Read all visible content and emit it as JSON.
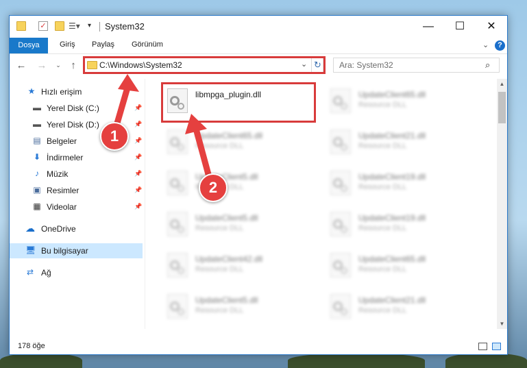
{
  "window": {
    "title": "System32",
    "controls": {
      "minimize": "—",
      "maximize": "☐",
      "close": "✕"
    },
    "help": "?"
  },
  "ribbon": {
    "tabs": [
      "Dosya",
      "Giriş",
      "Paylaş",
      "Görünüm"
    ]
  },
  "address_bar": {
    "path": "C:\\Windows\\System32",
    "search_placeholder": "Ara: System32"
  },
  "sidebar": {
    "items": [
      {
        "label": "Hızlı erişim",
        "icon": "star-icon"
      },
      {
        "label": "Yerel Disk (C:)",
        "icon": "drive-icon",
        "pinned": true
      },
      {
        "label": "Yerel Disk (D:)",
        "icon": "drive-icon",
        "pinned": true
      },
      {
        "label": "Belgeler",
        "icon": "documents-icon",
        "pinned": true
      },
      {
        "label": "İndirmeler",
        "icon": "download-icon",
        "pinned": true
      },
      {
        "label": "Müzik",
        "icon": "music-icon",
        "pinned": true
      },
      {
        "label": "Resimler",
        "icon": "pictures-icon",
        "pinned": true
      },
      {
        "label": "Videolar",
        "icon": "video-icon",
        "pinned": true
      },
      {
        "label": "OneDrive",
        "icon": "cloud-icon"
      },
      {
        "label": "Bu bilgisayar",
        "icon": "computer-icon",
        "selected": true
      },
      {
        "label": "Ağ",
        "icon": "network-icon"
      }
    ]
  },
  "files": [
    {
      "name": "libmpga_plugin.dll",
      "type": "",
      "highlighted": true
    },
    {
      "name": "UpdateClient65.dll",
      "type": "Resource DLL"
    },
    {
      "name": "UpdateClient65.dll",
      "type": "Resource DLL"
    },
    {
      "name": "UpdateClient21.dll",
      "type": "Resource DLL"
    },
    {
      "name": "UpdateClient5.dll",
      "type": "Resource DLL"
    },
    {
      "name": "UpdateClient19.dll",
      "type": "Resource DLL"
    },
    {
      "name": "UpdateClient5.dll",
      "type": "Resource DLL"
    },
    {
      "name": "UpdateClient19.dll",
      "type": "Resource DLL"
    },
    {
      "name": "UpdateClient42.dll",
      "type": "Resource DLL"
    },
    {
      "name": "UpdateClient65.dll",
      "type": "Resource DLL"
    },
    {
      "name": "UpdateClient5.dll",
      "type": "Resource DLL"
    },
    {
      "name": "UpdateClient21.dll",
      "type": "Resource DLL"
    }
  ],
  "status": {
    "item_count": "178 öğe"
  },
  "annotations": {
    "step1": "1",
    "step2": "2"
  },
  "colors": {
    "accent": "#1979ca",
    "highlight": "#d83b3b",
    "selected": "#cce8ff"
  }
}
